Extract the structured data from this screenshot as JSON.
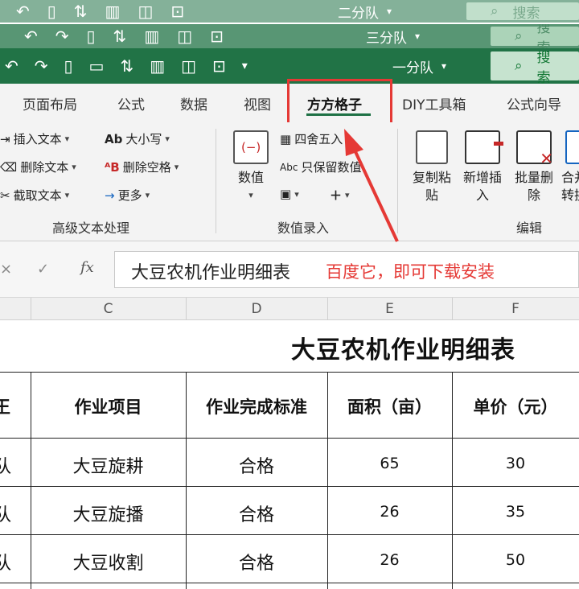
{
  "titlebars": [
    {
      "group_label": "二分队",
      "search_label": "搜索"
    },
    {
      "group_label": "三分队",
      "search_label": "搜索"
    },
    {
      "group_label": "一分队",
      "search_label": "搜索"
    }
  ],
  "menu": {
    "tabs": [
      "页面布局",
      "公式",
      "数据",
      "视图",
      "方方格子",
      "DIY工具箱",
      "公式向导"
    ],
    "active_tab": "方方格子"
  },
  "ribbon": {
    "advanced_text": {
      "items": [
        "插入文本",
        "删除文本",
        "截取文本"
      ],
      "items_right": [
        "大小写",
        "删除空格",
        "更多"
      ],
      "caption": "高级文本处理"
    },
    "value_entry": {
      "big_button": "数值",
      "items": [
        "四舍五入",
        "只保留数值"
      ],
      "caption": "数值录入"
    },
    "edit": {
      "buttons": [
        "复制粘贴",
        "新增插入",
        "批量删除",
        "合并转换"
      ],
      "caption": "编辑"
    }
  },
  "formula_bar": {
    "content": "大豆农机作业明细表",
    "annotation": "百度它，即可下载安装"
  },
  "columns": [
    "C",
    "D",
    "E",
    "F"
  ],
  "sheet": {
    "title": "大豆农机作业明细表",
    "headers": [
      "作业项目",
      "作业完成标准",
      "面积（亩）",
      "单价（元）"
    ],
    "partial_header": "王",
    "rows": [
      {
        "team": "队",
        "item": "大豆旋耕",
        "standard": "合格",
        "area": "65",
        "price": "30"
      },
      {
        "team": "队",
        "item": "大豆旋播",
        "standard": "合格",
        "area": "26",
        "price": "35"
      },
      {
        "team": "队",
        "item": "大豆收割",
        "standard": "合格",
        "area": "26",
        "price": "50"
      }
    ]
  },
  "colors": {
    "title_bar": "#217346",
    "highlight_red": "#e53935",
    "active_tab_underline": "#1e7145"
  }
}
